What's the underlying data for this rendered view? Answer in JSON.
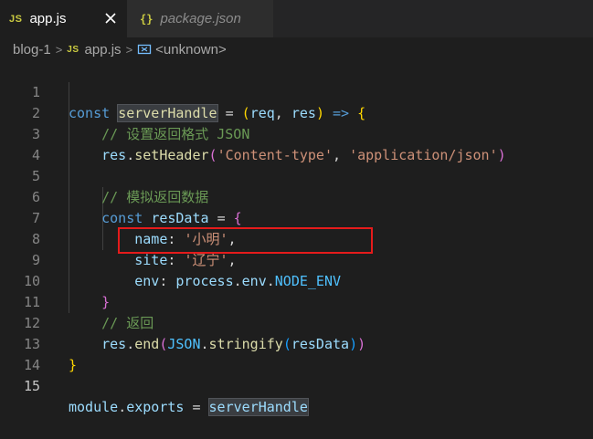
{
  "tabs": [
    {
      "badge": "JS",
      "label": "app.js",
      "active": true
    },
    {
      "badge": "{}",
      "label": "package.json",
      "active": false
    }
  ],
  "breadcrumb": {
    "folder": "blog-1",
    "badge": "JS",
    "file": "app.js",
    "symbol": "<unknown>"
  },
  "editor": {
    "current_line": 15,
    "lines": [
      {
        "n": "1"
      },
      {
        "n": "2"
      },
      {
        "n": "3"
      },
      {
        "n": "4"
      },
      {
        "n": "5"
      },
      {
        "n": "6"
      },
      {
        "n": "7"
      },
      {
        "n": "8"
      },
      {
        "n": "9"
      },
      {
        "n": "10"
      },
      {
        "n": "11"
      },
      {
        "n": "12"
      },
      {
        "n": "13"
      },
      {
        "n": "14"
      },
      {
        "n": "15"
      }
    ],
    "tokens": {
      "l1": [
        "const",
        "serverHandle",
        "=",
        "(",
        "req",
        ",",
        "res",
        ")",
        "=>",
        "{"
      ],
      "l2": [
        "// 设置返回格式 JSON"
      ],
      "l3": [
        "res",
        ".",
        "setHeader",
        "(",
        "'Content-type'",
        ",",
        "'application/json'",
        ")"
      ],
      "l5": [
        "// 模拟返回数据"
      ],
      "l6": [
        "const",
        "resData",
        "=",
        "{"
      ],
      "l7": [
        "name",
        ":",
        "'小明'",
        ","
      ],
      "l8": [
        "site",
        ":",
        "'辽宁'",
        ","
      ],
      "l9": [
        "env",
        ":",
        "process",
        ".",
        "env",
        ".",
        "NODE_ENV"
      ],
      "l10": [
        "}"
      ],
      "l11": [
        "// 返回"
      ],
      "l12": [
        "res",
        ".",
        "end",
        "(",
        "JSON",
        ".",
        "stringify",
        "(",
        "resData",
        ")",
        ")"
      ],
      "l13": [
        "}"
      ],
      "l15": [
        "module",
        ".",
        "exports",
        "=",
        "serverHandle"
      ]
    }
  },
  "colors": {
    "annotation_box": "#e51b1b",
    "keyword": "#569cd6",
    "variable": "#9cdcfe",
    "string": "#ce9178",
    "comment": "#6a9955",
    "function": "#dcdcaa"
  }
}
